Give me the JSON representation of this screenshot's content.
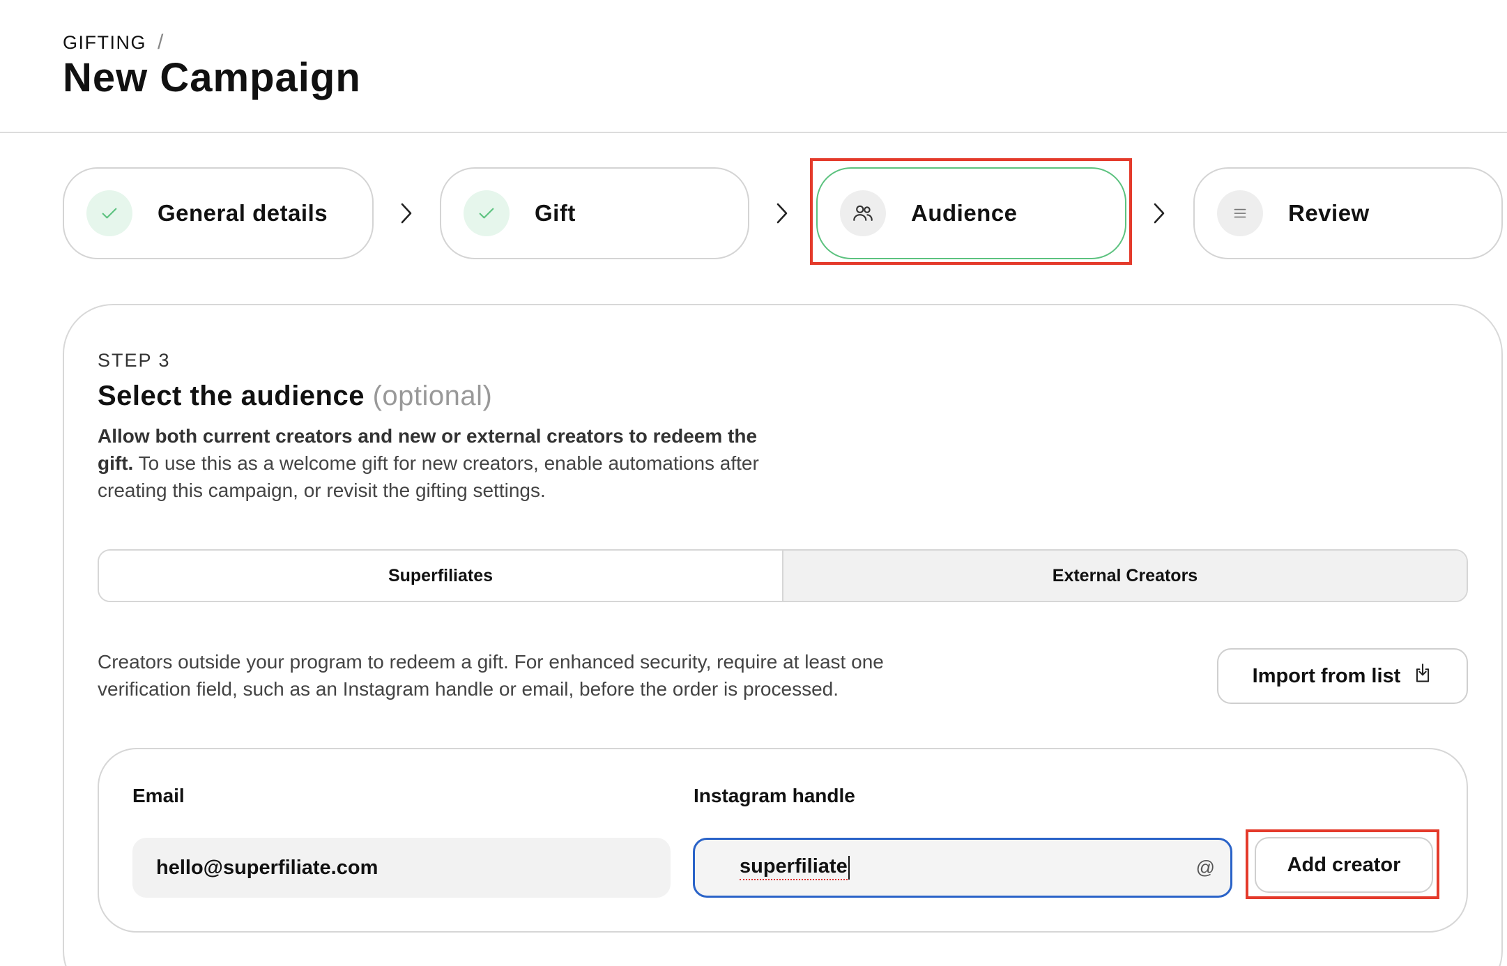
{
  "header": {
    "breadcrumb": "GIFTING",
    "breadcrumb_separator": "/",
    "title": "New Campaign"
  },
  "stepper": {
    "steps": [
      {
        "label": "General details",
        "state": "completed",
        "icon": "check-icon"
      },
      {
        "label": "Gift",
        "state": "completed",
        "icon": "check-icon"
      },
      {
        "label": "Audience",
        "state": "active",
        "icon": "users-icon"
      },
      {
        "label": "Review",
        "state": "pending",
        "icon": "list-icon"
      }
    ]
  },
  "section": {
    "kicker": "STEP 3",
    "title": "Select the audience",
    "title_optional": "(optional)",
    "desc_bold": "Allow both current creators and new or external creators to redeem the gift.",
    "desc_rest": " To use this as a welcome gift for new creators, enable automations after creating this campaign, or revisit the gifting settings."
  },
  "tabs": [
    {
      "label": "Superfiliates",
      "selected": false
    },
    {
      "label": "External Creators",
      "selected": true
    }
  ],
  "external": {
    "description": "Creators outside your program to redeem a gift. For enhanced security, require at least one verification field, such as an Instagram handle or email, before the order is processed.",
    "import_label": "Import from list"
  },
  "form": {
    "email_label": "Email",
    "email_value": "hello@superfiliate.com",
    "instagram_label": "Instagram handle",
    "instagram_value": "superfiliate",
    "instagram_suffix": "@",
    "add_button_label": "Add creator"
  },
  "colors": {
    "accent_green": "#5cc27f",
    "focus_blue": "#2a63c8",
    "highlight_red": "#e43a2b"
  }
}
